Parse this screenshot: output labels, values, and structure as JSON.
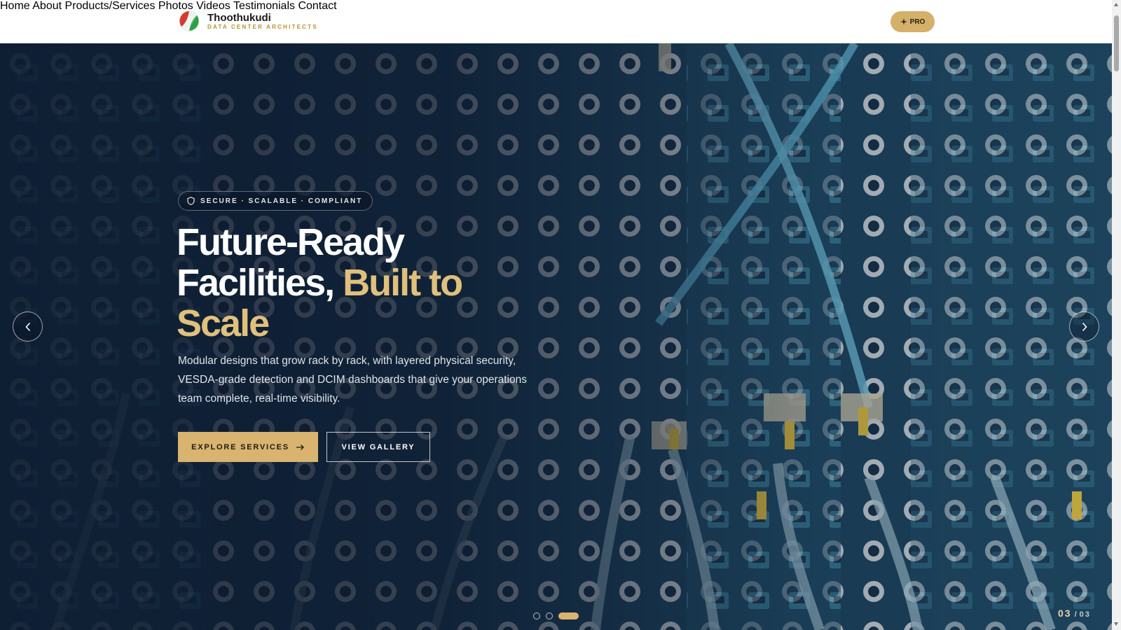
{
  "brand": {
    "name": "Thoothukudi",
    "tagline": "DATA CENTER ARCHITECTS"
  },
  "nav": {
    "items": [
      {
        "label": "Home"
      },
      {
        "label": "About"
      },
      {
        "label": "Products/Services"
      },
      {
        "label": "Photos"
      },
      {
        "label": "Videos"
      },
      {
        "label": "Testimonials"
      },
      {
        "label": "Contact"
      }
    ],
    "pro_label": "PRO",
    "pro_icon": "sparkle-icon"
  },
  "hero": {
    "badge_icon": "shield-icon",
    "badge_text": "SECURE · SCALABLE · COMPLIANT",
    "headline_line1": "Future-Ready",
    "headline_line2a": "Facilities, ",
    "headline_line2b": "Built to",
    "headline_line3": "Scale",
    "description": "Modular designs that grow rack by rack, with layered physical security, VESDA-grade detection and DCIM dashboards that give your operations team complete, real-time visibility.",
    "primary_button": "EXPLORE SERVICES",
    "primary_button_icon": "arrow-right-icon",
    "secondary_button": "VIEW GALLERY",
    "slide_current": "03",
    "slide_separator": "/",
    "slide_total": "03",
    "active_slide": 3,
    "slide_count": 3
  },
  "colors": {
    "accent": "#d8b470",
    "nav_bg": "#ffffff",
    "hero_overlay": "#0c182c"
  }
}
